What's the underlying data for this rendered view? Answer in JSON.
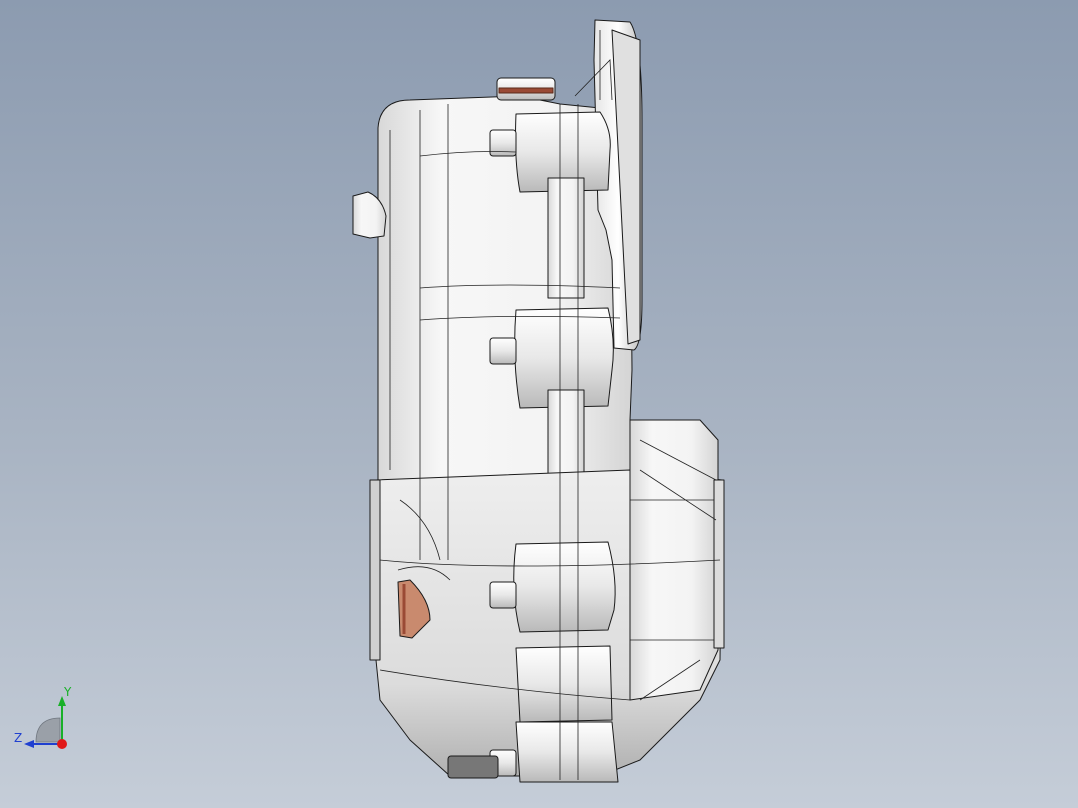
{
  "viewport": {
    "background_top": "#8c9bb0",
    "background_bottom": "#c5cdd8",
    "model_fill": "#f2f2f2",
    "model_edge": "#1a1a1a",
    "seal_color": "#9a4a35"
  },
  "triad": {
    "y_label": "Y",
    "z_label": "Z",
    "y_color": "#19b028",
    "z_color": "#2040d0",
    "x_color": "#e01818"
  }
}
